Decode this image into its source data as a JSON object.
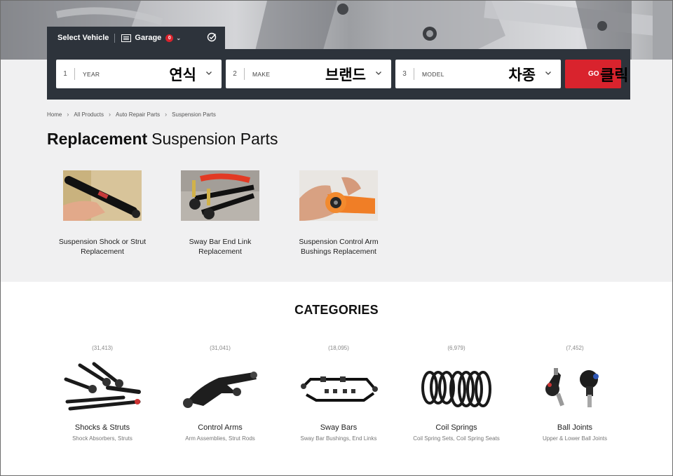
{
  "vehicle_tab": {
    "title": "Select Vehicle",
    "garage_label": "Garage",
    "garage_count": "0"
  },
  "selectors": [
    {
      "num": "1",
      "label": "YEAR",
      "overlay": "연식"
    },
    {
      "num": "2",
      "label": "MAKE",
      "overlay": "브랜드"
    },
    {
      "num": "3",
      "label": "MODEL",
      "overlay": "차종"
    }
  ],
  "go_button": {
    "label": "GO",
    "overlay": "클릭"
  },
  "breadcrumb": [
    "Home",
    "All Products",
    "Auto Repair Parts",
    "Suspension Parts"
  ],
  "page_title": {
    "bold": "Replacement",
    "light": "Suspension Parts"
  },
  "featured": [
    {
      "caption_line1": "Suspension Shock or Strut",
      "caption_line2": "Replacement"
    },
    {
      "caption_line1": "Sway Bar End Link",
      "caption_line2": "Replacement"
    },
    {
      "caption_line1": "Suspension Control Arm",
      "caption_line2": "Bushings Replacement"
    }
  ],
  "categories_heading": "CATEGORIES",
  "categories": [
    {
      "count": "(31,413)",
      "name": "Shocks & Struts",
      "sub": "Shock Absorbers, Struts"
    },
    {
      "count": "(31,041)",
      "name": "Control Arms",
      "sub": "Arm Assemblies, Strut Rods"
    },
    {
      "count": "(18,095)",
      "name": "Sway Bars",
      "sub": "Sway Bar Bushings, End Links"
    },
    {
      "count": "(6,979)",
      "name": "Coil Springs",
      "sub": "Coil Spring Sets, Coil Spring Seats"
    },
    {
      "count": "(7,452)",
      "name": "Ball Joints",
      "sub": "Upper & Lower Ball Joints"
    }
  ],
  "colors": {
    "dark_bar": "#2d333b",
    "accent_red": "#d9232d",
    "page_gray": "#f0f0f1"
  }
}
